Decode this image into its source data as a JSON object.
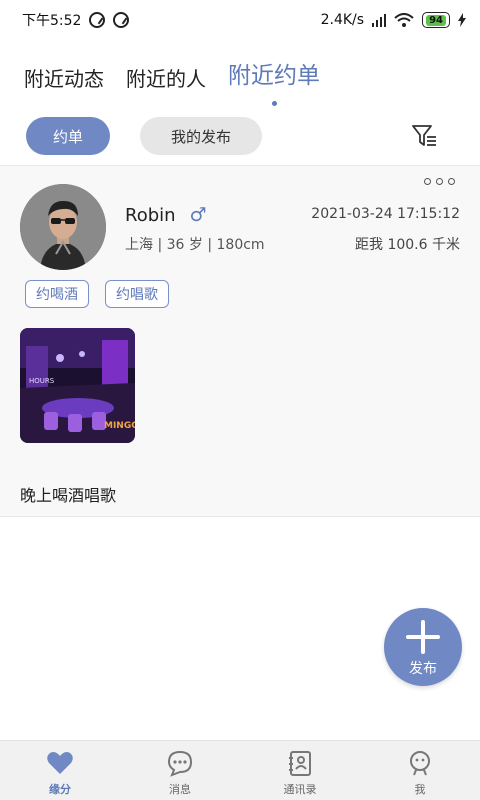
{
  "status": {
    "time": "下午5:52",
    "network_speed": "2.4K/s",
    "battery": "94"
  },
  "tabs": [
    {
      "label": "附近动态"
    },
    {
      "label": "附近的人"
    },
    {
      "label": "附近约单",
      "active": true
    }
  ],
  "subtabs": {
    "active": "约单",
    "inactive": "我的发布"
  },
  "post": {
    "user_name": "Robin",
    "gender_symbol": "♂",
    "meta": "上海 | 36 岁 | 180cm",
    "time": "2021-03-24 17:15:12",
    "distance": "距我 100.6 千米",
    "tags": [
      "约喝酒",
      "约唱歌"
    ],
    "image_text": [
      "HOURS",
      "MINGO"
    ],
    "text": "晚上喝酒唱歌"
  },
  "fab": {
    "label": "发布"
  },
  "nav": [
    {
      "label": "缘分",
      "icon": "heart-icon",
      "active": true
    },
    {
      "label": "消息",
      "icon": "chat-icon"
    },
    {
      "label": "通讯录",
      "icon": "contacts-icon"
    },
    {
      "label": "我",
      "icon": "profile-icon"
    }
  ],
  "colors": {
    "accent": "#7088c4",
    "accent_text": "#5f7ab8"
  }
}
